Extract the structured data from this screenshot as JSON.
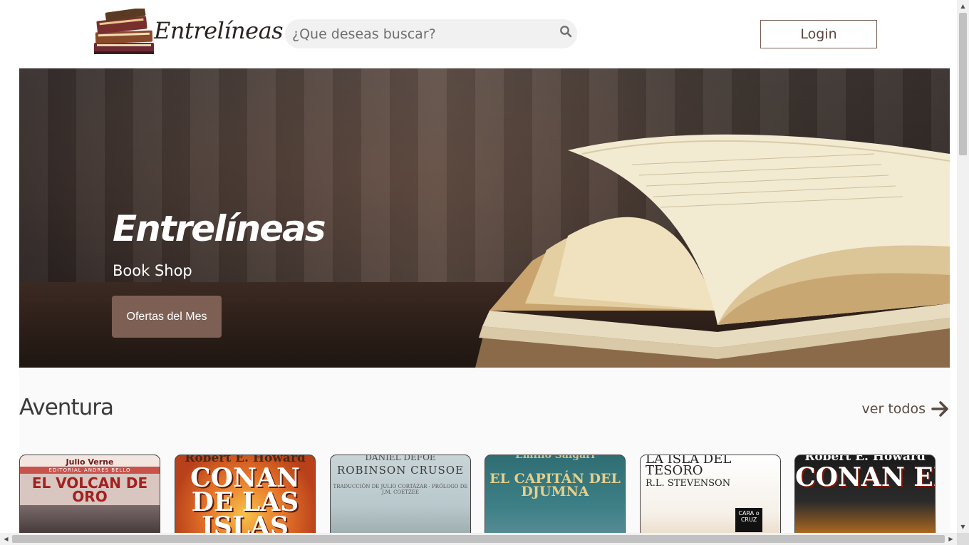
{
  "header": {
    "logo_text": "Entrelíneas",
    "search_placeholder": "¿Que deseas buscar?",
    "login_label": "Login"
  },
  "hero": {
    "title": "Entrelíneas",
    "subtitle": "Book Shop",
    "cta_label": "Ofertas del Mes"
  },
  "category": {
    "title": "Aventura",
    "see_all_label": "ver todos"
  },
  "books": [
    {
      "top": "Julio Verne",
      "band": "EDITORIAL ANDRES BELLO",
      "title": "EL VOLCAN DE ORO"
    },
    {
      "top": "Robert E. Howard",
      "title": "CONAN DE LAS ISLAS"
    },
    {
      "top": "DANIEL DEFOE",
      "title": "ROBINSON CRUSOE",
      "small": "TRADUCCIÓN DE JULIO CORTÁZAR · PRÓLOGO DE J.M. COETZEE"
    },
    {
      "top": "Emilio Salgari",
      "title": "EL CAPITÁN DEL DJUMNA"
    },
    {
      "top": "LA ISLA DEL TESORO",
      "title": "R.L. STEVENSON",
      "logo": "CARA o CRUZ"
    },
    {
      "top": "Robert E. Howard",
      "title": "CONAN EL USURPADOR"
    }
  ],
  "colors": {
    "accent_brown": "#7d5f54",
    "login_border": "#7a5f55"
  },
  "icons": [
    "search-icon",
    "arrow-right-icon",
    "books-logo-icon"
  ]
}
